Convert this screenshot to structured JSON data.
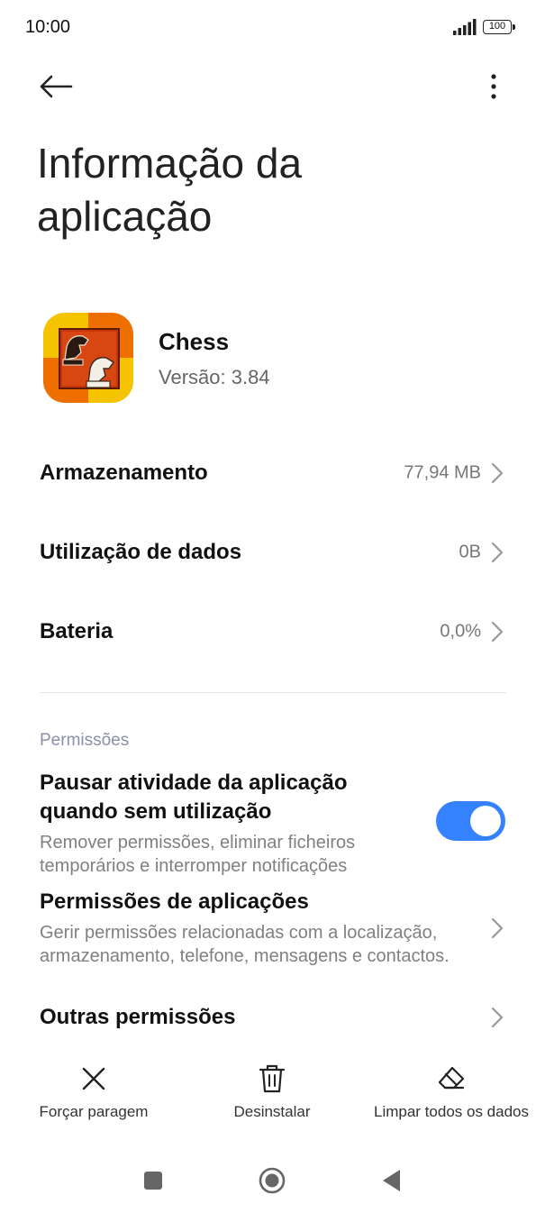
{
  "status_bar": {
    "time": "10:00",
    "battery": "100",
    "icons": [
      "signal-icon",
      "battery-icon"
    ]
  },
  "header": {
    "title": "Informação da aplicação",
    "icons": [
      "back-arrow-icon",
      "more-vert-icon"
    ]
  },
  "app": {
    "name": "Chess",
    "version": "Versão: 3.84",
    "icon": "chess-app-icon"
  },
  "rows": [
    {
      "label": "Armazenamento",
      "value": "77,94 MB"
    },
    {
      "label": "Utilização de dados",
      "value": "0B"
    },
    {
      "label": "Bateria",
      "value": "0,0%"
    }
  ],
  "permissions": {
    "header": "Permissões",
    "pause": {
      "title": "Pausar atividade da aplicação quando sem utilização",
      "subtitle": "Remover permissões, eliminar ficheiros temporários e interromper notificações",
      "enabled": true
    },
    "app_permissions": {
      "title": "Permissões de aplicações",
      "subtitle": "Gerir permissões relacionadas com a localização, armazenamento, telefone, mensagens e contactos."
    },
    "other": {
      "title": "Outras permissões"
    }
  },
  "actions": [
    {
      "label": "Forçar paragem",
      "icon": "close-icon"
    },
    {
      "label": "Desinstalar",
      "icon": "trash-icon"
    },
    {
      "label": "Limpar todos os dados",
      "icon": "eraser-icon"
    }
  ],
  "nav": {
    "icons": [
      "square-recents-icon",
      "circle-home-icon",
      "triangle-back-icon"
    ]
  },
  "colors": {
    "accent": "#3482ff",
    "section_header": "#8a8fa8",
    "secondary_text": "#808080"
  }
}
